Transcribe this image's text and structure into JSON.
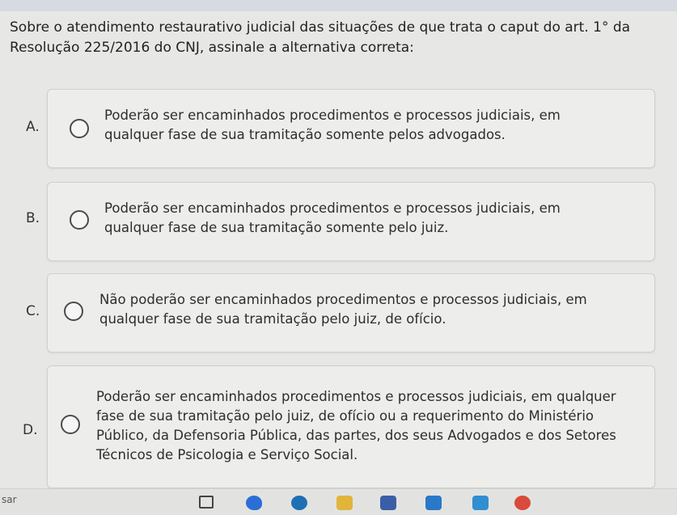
{
  "question": {
    "text": "Sobre o atendimento restaurativo judicial das situações de que trata o caput do art. 1° da Resolução 225/2016 do CNJ, assinale a alternativa correta:"
  },
  "options": [
    {
      "letter": "A.",
      "text": "Poderão ser encaminhados procedimentos e processos judiciais, em qualquer fase de sua tramitação somente pelos advogados."
    },
    {
      "letter": "B.",
      "text": "Poderão ser encaminhados procedimentos e processos judiciais, em qualquer fase de sua tramitação somente pelo juiz."
    },
    {
      "letter": "C.",
      "text": "Não poderão ser encaminhados procedimentos e processos judiciais, em qualquer fase de sua tramitação pelo juiz, de ofício."
    },
    {
      "letter": "D.",
      "text": "Poderão ser encaminhados procedimentos e processos judiciais, em qualquer fase de sua tramitação pelo juiz, de ofício ou a requerimento do Ministério Público, da Defensoria Pública, das partes, dos seus Advogados e dos Setores Técnicos de Psicologia e Serviço Social."
    }
  ],
  "taskbar": {
    "search_fragment": "sar",
    "icons": [
      "task-view-icon",
      "paint-icon",
      "edge-icon",
      "file-explorer-icon",
      "store-icon",
      "mail-icon",
      "photos-icon",
      "chrome-icon"
    ]
  }
}
